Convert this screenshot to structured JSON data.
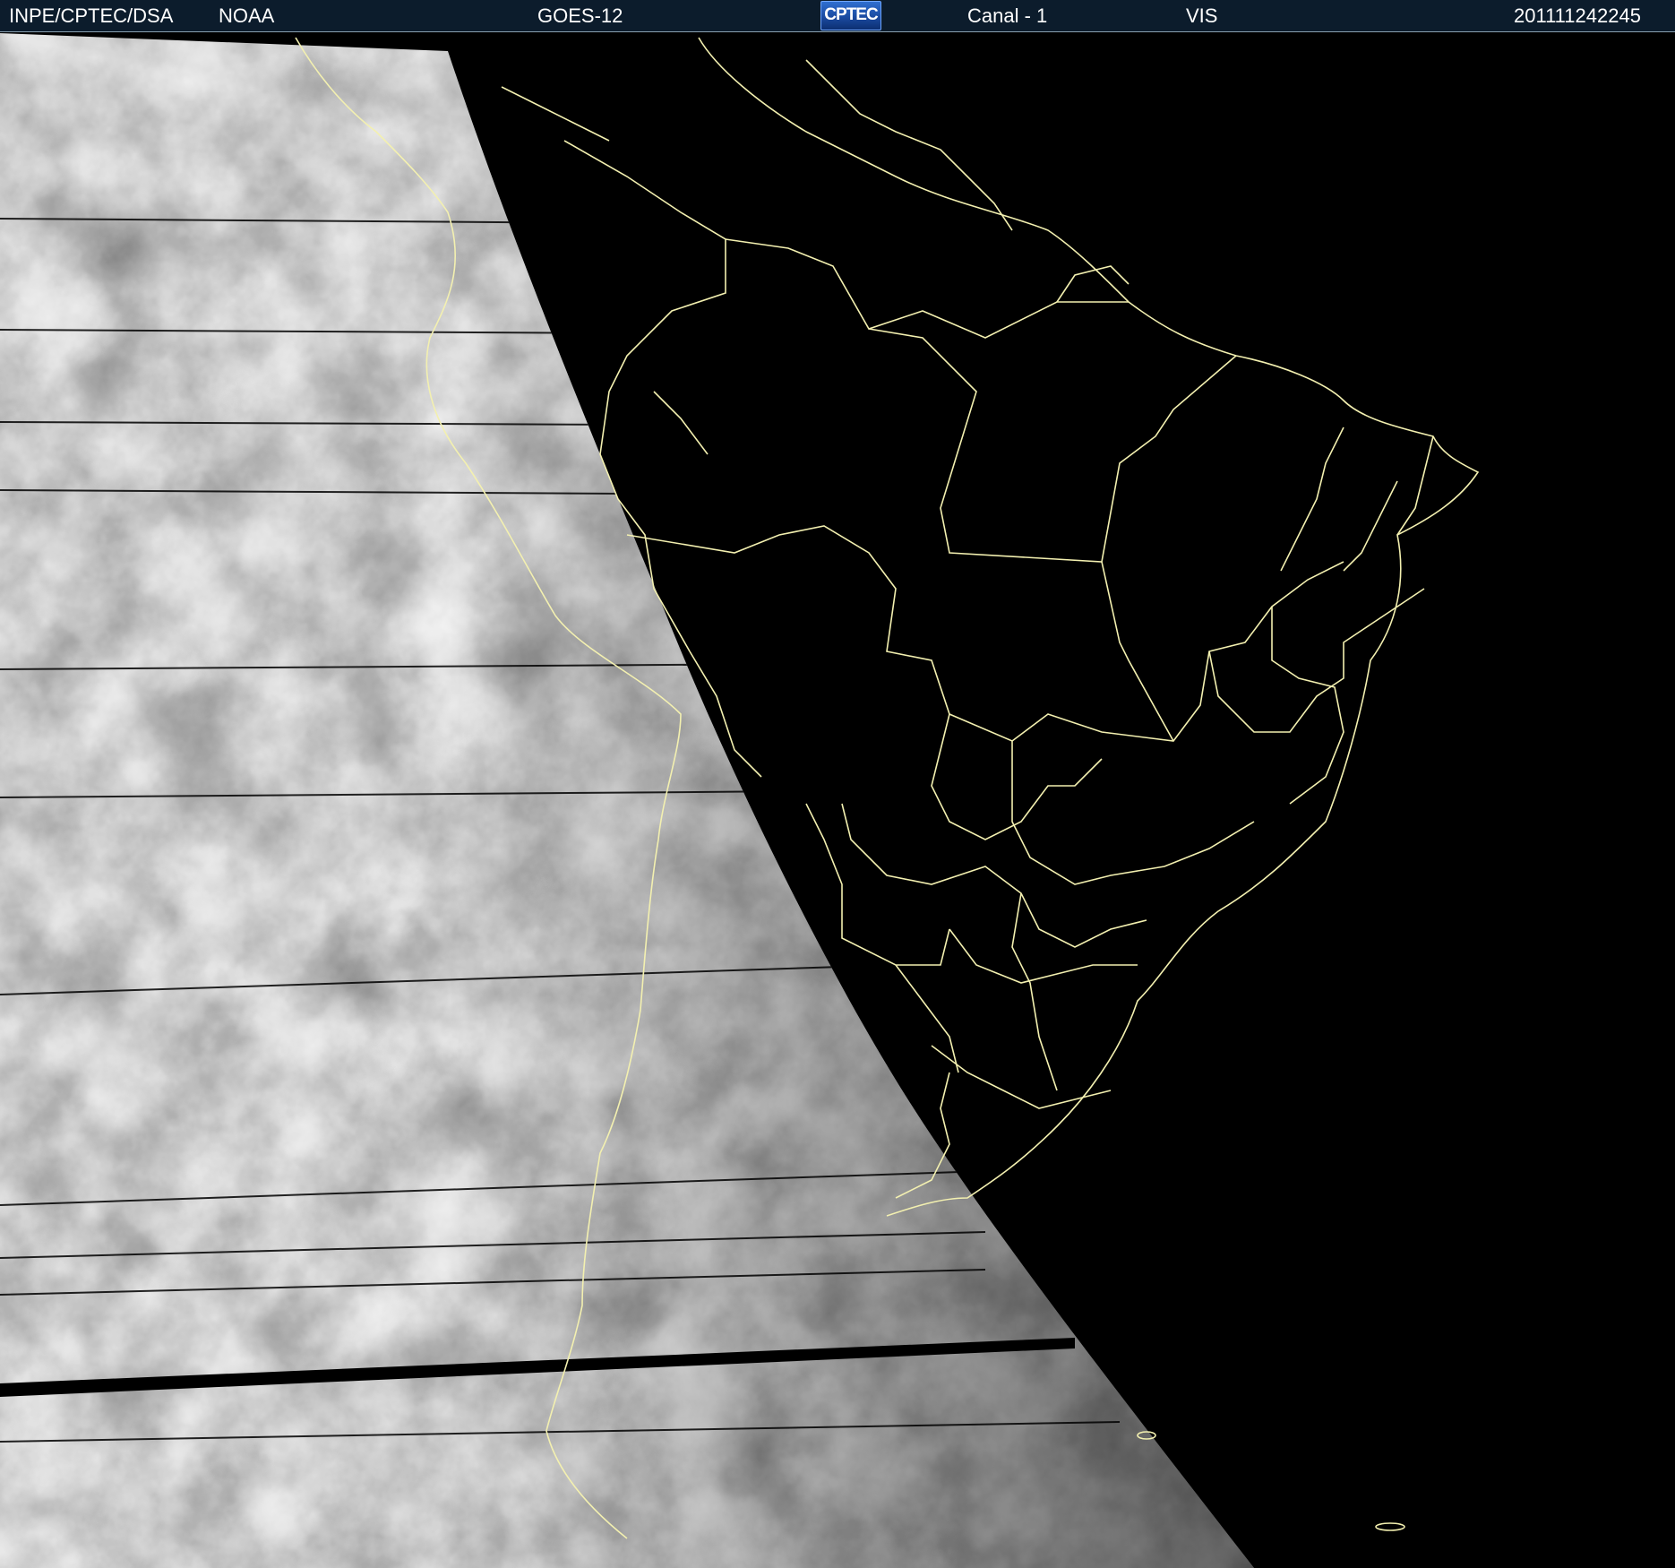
{
  "header": {
    "source": "INPE/CPTEC/DSA",
    "agency": "NOAA",
    "satellite": "GOES-12",
    "logo_text": "CPTEC",
    "channel": "Canal - 1",
    "band": "VIS",
    "timestamp": "201111242245"
  },
  "image": {
    "background_color": "#000000",
    "border_line_color": "#f3f0b0",
    "cloud_color": "#e8e8e8"
  }
}
